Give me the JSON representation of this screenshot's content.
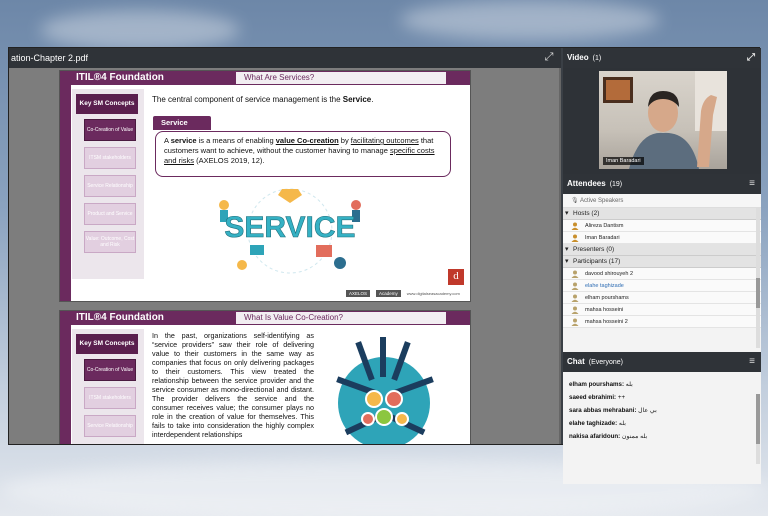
{
  "document": {
    "title": "ation-Chapter 2.pdf"
  },
  "slide1": {
    "brand": "ITIL®4 Foundation",
    "topic": "What Are Services?",
    "key_concepts": "Key SM Concepts",
    "nav": [
      "Co-Creation of Value",
      "ITSM stakeholders",
      "Service Relationship",
      "Product and Service",
      "Value: Outcome, Cost and Risk"
    ],
    "intro_prefix": "The central component of service management is the ",
    "intro_bold": "Service",
    "intro_suffix": ".",
    "svc_tab": "Service",
    "definition": {
      "p1": "A ",
      "b1": "service",
      "p2": " is a means of enabling ",
      "u1": "value Co-creation",
      "p3": " by ",
      "u2": "facilitating outcomes",
      "p4": " that customers want to achieve, without the customer having to manage ",
      "u3": "specific costs and risks",
      "p5": " (AXELOS 2019, 12)."
    },
    "art_word": "SERVICE",
    "footer": [
      "AXELOS",
      "Academy",
      "www.digitalseasacademy.com"
    ],
    "d_logo": "d"
  },
  "slide2": {
    "brand": "ITIL®4 Foundation",
    "topic": "What Is Value Co-Creation?",
    "key_concepts": "Key SM Concepts",
    "nav": [
      "Co-Creation of Value",
      "ITSM stakeholders",
      "Service Relationship"
    ],
    "body": "In the past, organizations self-identifying as “service providers” saw their role of delivering value to their customers in the same way as companies that focus on only delivering packages to their customers. This view treated the relationship between the service provider and the service consumer as mono-directional and distant. The provider delivers the service and the consumer receives value; the consumer plays no role in the creation of value for themselves. This fails to take into consideration the highly complex interdependent relationships"
  },
  "video": {
    "title": "Video",
    "count": "(1)",
    "presenter": "Iman Baradari"
  },
  "attendees": {
    "title": "Attendees",
    "count": "(19)",
    "active_speakers": "Active Speakers",
    "hosts_label": "Hosts (2)",
    "hosts": [
      "Alireza Dantism",
      "Iman Baradari"
    ],
    "presenters_label": "Presenters (0)",
    "participants_label": "Participants (17)",
    "participants": [
      "davood shirouyeh 2",
      "elahe taghizade",
      "elham pourshams",
      "mahsa hosseini",
      "mahsa hosseini 2"
    ]
  },
  "chat": {
    "title": "Chat",
    "scope": "(Everyone)",
    "messages": [
      {
        "user": "elham pourshams:",
        "text": "بله"
      },
      {
        "user": "saeed ebrahimi:",
        "text": "++"
      },
      {
        "user": "sara abbas mehrabani:",
        "text": "بي عال"
      },
      {
        "user": "elahe taghizade:",
        "text": "بله"
      },
      {
        "user": "nakisa afaridoun:",
        "text": "بله ممنون"
      }
    ]
  },
  "colors": {
    "brand_purple": "#6b2a5e",
    "panel_header": "#2f3338",
    "link_blue": "#2e6db4"
  }
}
